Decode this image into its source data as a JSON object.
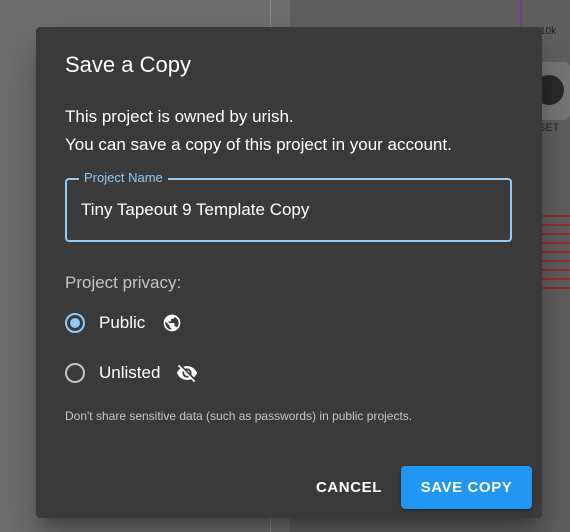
{
  "background": {
    "fragment_top": "10k",
    "fragment_reset": "SET"
  },
  "dialog": {
    "title": "Save a Copy",
    "message_line1": "This project is owned by urish.",
    "message_line2": "You can save a copy of this project in your account.",
    "project_name": {
      "label": "Project Name",
      "value": "Tiny Tapeout 9 Template Copy"
    },
    "privacy": {
      "label": "Project privacy:",
      "options": [
        {
          "label": "Public",
          "icon": "globe-icon",
          "selected": true
        },
        {
          "label": "Unlisted",
          "icon": "eye-off-icon",
          "selected": false
        }
      ]
    },
    "hint": "Don't share sensitive data (such as passwords) in public projects.",
    "buttons": {
      "cancel": "CANCEL",
      "save": "SAVE COPY"
    }
  },
  "colors": {
    "accent": "#90caf9",
    "primary_button": "#2196f3",
    "dialog_background": "#3a3a3a"
  }
}
